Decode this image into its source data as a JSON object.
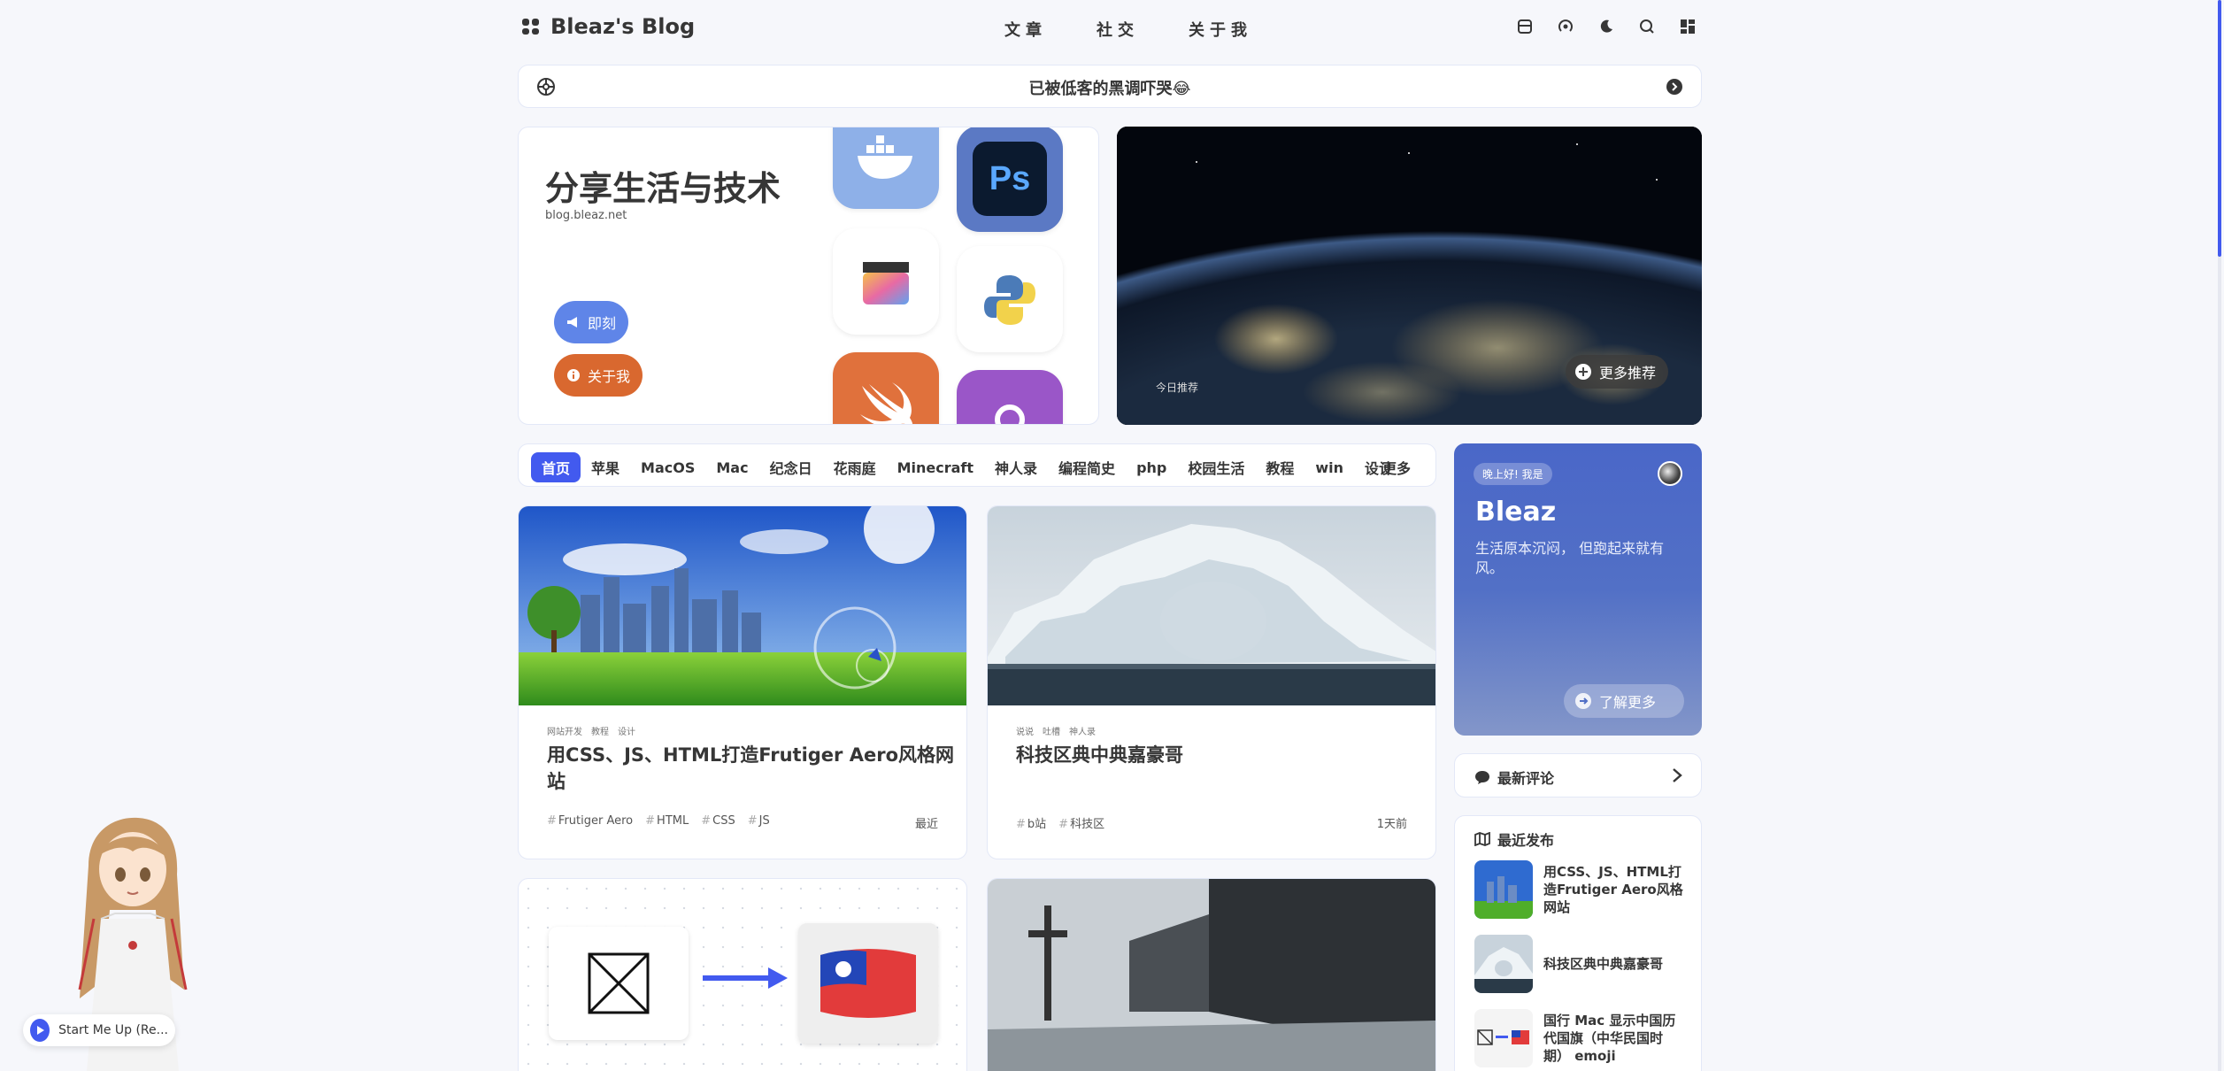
{
  "nav": {
    "brand": "Bleaz's Blog",
    "menu": [
      "文章",
      "社交",
      "关于我"
    ]
  },
  "notice": {
    "text": "已被低客的黑调吓哭😂"
  },
  "hero": {
    "title": "分享生活与技术",
    "site": "blog.bleaz.net",
    "btn_moment": "即刻",
    "btn_about": "关于我",
    "apps": [
      "docker-icon",
      "photoshop-icon",
      "final-cut-icon",
      "python-icon",
      "swift-icon",
      "podcast-icon"
    ],
    "ps_label": "Ps"
  },
  "featured": {
    "label": "今日推荐",
    "more": "更多推荐"
  },
  "categories": {
    "items": [
      "首页",
      "苹果",
      "MacOS",
      "Mac",
      "纪念日",
      "花雨庭",
      "Minecraft",
      "神人录",
      "编程简史",
      "php",
      "校园生活",
      "教程",
      "win",
      "设计"
    ],
    "more": "更多",
    "active_index": 0
  },
  "posts": [
    {
      "categories": [
        "网站开发",
        "教程",
        "设计"
      ],
      "title": "用CSS、JS、HTML打造Frutiger Aero风格网站",
      "tags": [
        "Frutiger Aero",
        "HTML",
        "CSS",
        "JS"
      ],
      "time": "最近"
    },
    {
      "categories": [
        "说说",
        "吐槽",
        "神人录"
      ],
      "title": "科技区典中典嘉豪哥",
      "tags": [
        "b站",
        "科技区"
      ],
      "time": "1天前"
    }
  ],
  "author": {
    "greeting": "晚上好! 我是",
    "name": "Bleaz",
    "desc": "生活原本沉闷， 但跑起来就有风。",
    "learn_more": "了解更多"
  },
  "widgets": {
    "comments_title": "最新评论",
    "recent_title": "最近发布",
    "recent": [
      "用CSS、JS、HTML打造Frutiger Aero风格网站",
      "科技区典中典嘉豪哥",
      "国行 Mac 显示中国历代国旗（中华民国时期） emoji"
    ]
  },
  "player": {
    "song": "Start Me Up (Re..."
  },
  "colors": {
    "accent": "#425aef",
    "about_btn": "#d9682f",
    "moment_btn": "#5f85e8"
  }
}
